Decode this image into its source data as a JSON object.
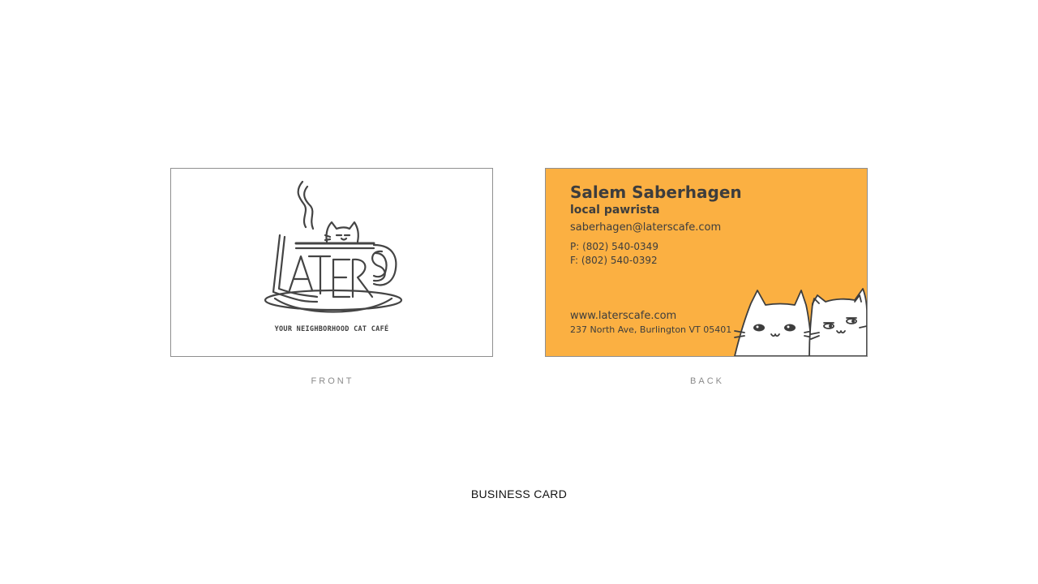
{
  "front": {
    "logo_icon": "laters-cat-cup-logo-icon",
    "tagline": "YOUR NEIGHBORHOOD CAT CAFÉ",
    "caption": "FRONT"
  },
  "back": {
    "name": "Salem Saberhagen",
    "role": "local pawrista",
    "email": "saberhagen@laterscafe.com",
    "phone": "P: (802) 540-0349",
    "fax": "F: (802) 540-0392",
    "website": "www.laterscafe.com",
    "address": "237 North Ave, Burlington VT 05401",
    "illustration_icon": "two-cats-peeking-icon",
    "caption": "BACK"
  },
  "section_title": "BUSINESS CARD",
  "colors": {
    "back_background": "#fbb042",
    "ink": "#3d3d3d",
    "caption": "#8a8a8a"
  }
}
